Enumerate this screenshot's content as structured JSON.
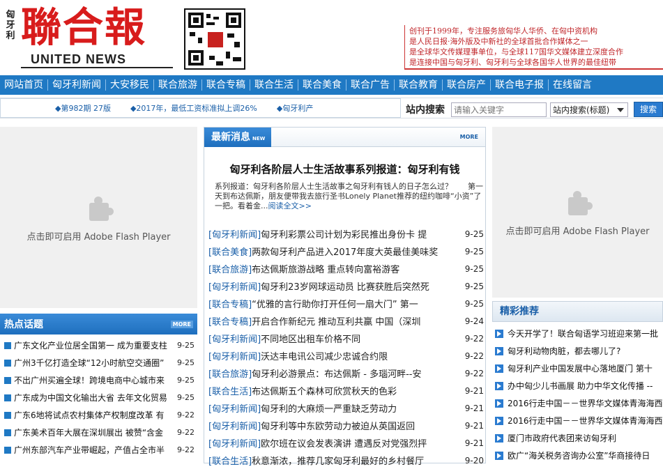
{
  "header": {
    "side_text": "匈牙利",
    "logo_cn": "聯合報",
    "logo_en": "UNITED NEWS",
    "tagline": [
      "创刊于1999年，专注服务旅匈华人华侨、在匈中资机构",
      "是人民日报·海外版及中新社的全球首批合作媒体之一",
      "是全球华文传媒理事单位，与全球117国华文媒体建立深度合作",
      "是连接中国与匈牙利、匈牙利与全球各国华人世界的最佳纽带"
    ]
  },
  "nav": [
    "网站首页",
    "匈牙利新闻",
    "大安移民",
    "联合旅游",
    "联合专稿",
    "联合生活",
    "联合美食",
    "联合广告",
    "联合教育",
    "联合房产",
    "联合电子报",
    "在线留言"
  ],
  "ticker": [
    "◆第982期 27版",
    "◆2017年，最低工资标准拟上调26%",
    "◆匈牙利产"
  ],
  "search": {
    "label": "站内搜索",
    "placeholder": "请输入关键字",
    "scope": "站内搜索(标题)",
    "button": "搜索"
  },
  "flash": {
    "text": "点击即可启用 Adobe Flash Player"
  },
  "latest": {
    "title": "最新消息",
    "title_en": "NEW",
    "more": "MORE",
    "headline": "匈牙利各阶层人士生活故事系列报道：匈牙利有钱",
    "summary_text": "系列报道：匈牙利各阶层人士生活故事之匈牙利有钱人的日子怎么过？　　第一天到布达佩斯，朋友便带我去旅行圣书Lonely Planet推荐的纽约咖啡“小资”了一把。看着金...",
    "read_all": "阅读全文>>",
    "items": [
      {
        "cat": "[匈牙利新闻]",
        "title": "匈牙利彩票公司计划为彩民推出身份卡 提",
        "date": "9-25"
      },
      {
        "cat": "[联合美食]",
        "title": "两款匈牙利产品进入2017年度大英最佳美味奖",
        "date": "9-25"
      },
      {
        "cat": "[联合旅游]",
        "title": "布达佩斯旅游战略 重点转向富裕游客",
        "date": "9-25"
      },
      {
        "cat": "[匈牙利新闻]",
        "title": "匈牙利23岁网球运动员 比赛获胜后突然死",
        "date": "9-25"
      },
      {
        "cat": "[联合专稿]",
        "title": "“优雅的言行助你打开任何一扇大门” 第一",
        "date": "9-25"
      },
      {
        "cat": "[联合专稿]",
        "title": "开启合作新纪元 推动互利共赢 中国（深圳",
        "date": "9-24"
      },
      {
        "cat": "[匈牙利新闻]",
        "title": "不同地区出租车价格不同",
        "date": "9-22"
      },
      {
        "cat": "[匈牙利新闻]",
        "title": "沃达丰电讯公司减少忠诚合约限",
        "date": "9-22"
      },
      {
        "cat": "[联合旅游]",
        "title": "匈牙利必游景点：布达佩斯 - 多瑙河畔--安",
        "date": "9-22"
      },
      {
        "cat": "[联合生活]",
        "title": "布达佩斯五个森林可欣赏秋天的色彩",
        "date": "9-21"
      },
      {
        "cat": "[匈牙利新闻]",
        "title": "匈牙利的大麻烦一严重缺乏劳动力",
        "date": "9-21"
      },
      {
        "cat": "[匈牙利新闻]",
        "title": "匈牙利等中东欧劳动力被迫从英国返回",
        "date": "9-21"
      },
      {
        "cat": "[匈牙利新闻]",
        "title": "欧尔班在议会发表演讲 遭遇反对党强烈抨",
        "date": "9-21"
      },
      {
        "cat": "[联合生活]",
        "title": "秋意渐浓，推荐几家匈牙利最好的乡村餐厅",
        "date": "9-20"
      }
    ]
  },
  "hot": {
    "title": "热点话题",
    "more": "MORE",
    "items": [
      {
        "title": "广东文化产业位居全国第一 成为重要支柱",
        "date": "9-25"
      },
      {
        "title": "广州3千亿打造全球“12小时航空交通圈”",
        "date": "9-25"
      },
      {
        "title": "不出广州买遍全球！跨境电商中心城市来",
        "date": "9-25"
      },
      {
        "title": "广东成为中国文化输出大省 去年文化贸易",
        "date": "9-25"
      },
      {
        "title": "广东6地将试点农村集体产权制度改革 有",
        "date": "9-22"
      },
      {
        "title": "广东美术百年大展在深圳展出 被赞“含金",
        "date": "9-22"
      },
      {
        "title": "广州东部汽车产业带崛起，产值占全市半",
        "date": "9-22"
      }
    ]
  },
  "recommend": {
    "title": "精彩推荐",
    "items": [
      "今天开学了！联合匈语学习班迎来第一批",
      "匈牙利动物肉脏，都去哪儿了?",
      "匈牙利产业中国发展中心落地厦门 第十",
      "办中匈少儿书画展 助力中华文化传播 --",
      "2016行走中国－－世界华文媒体青海海西",
      "2016行走中国－－世界华文媒体青海海西",
      "厦门市政府代表团来访匈牙利",
      "欧广“海关税务咨询办公室”华商接待日"
    ]
  }
}
